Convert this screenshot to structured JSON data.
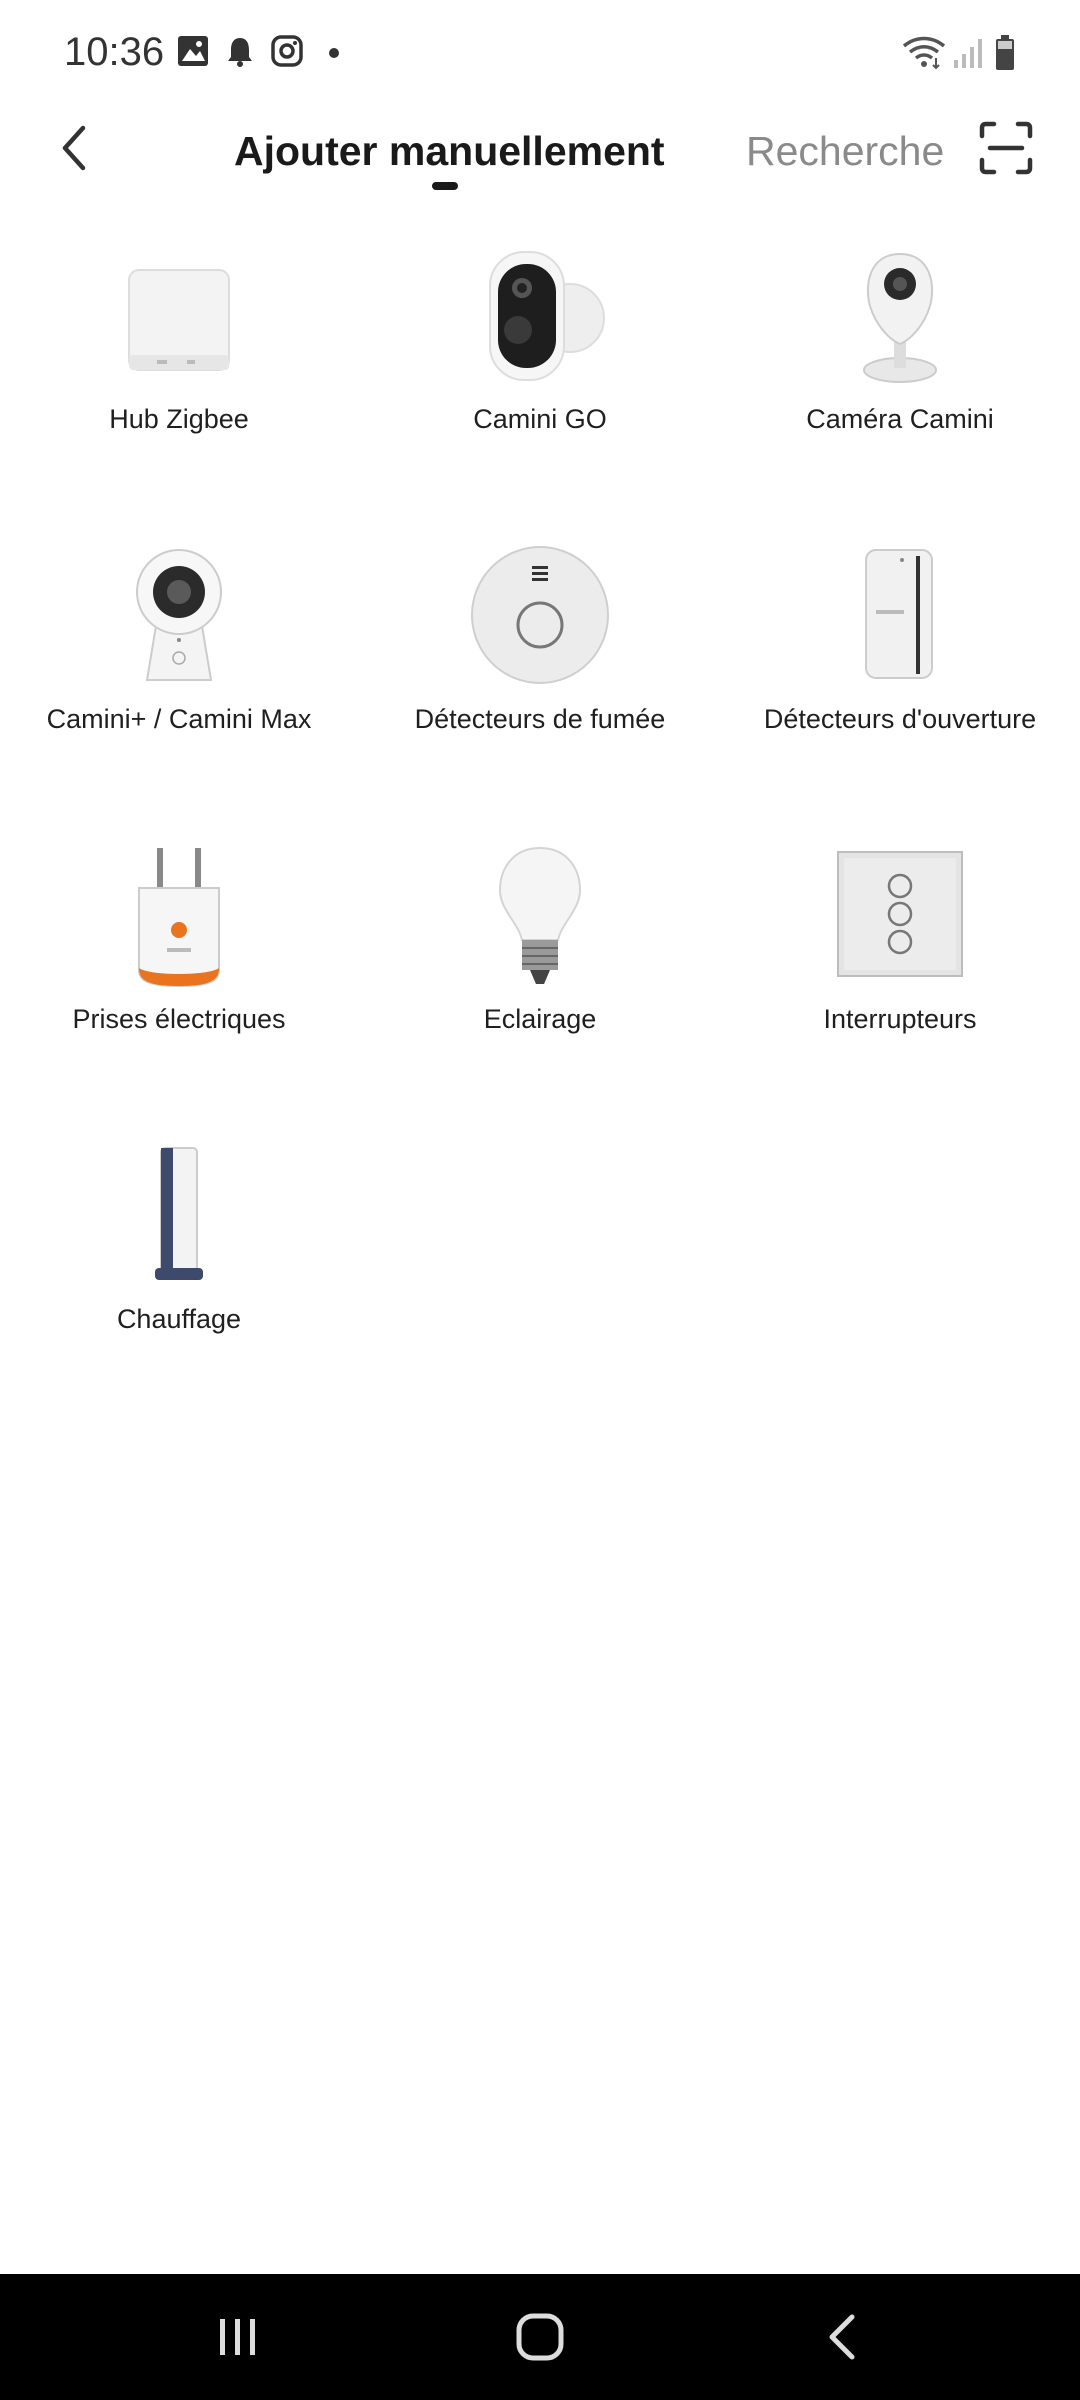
{
  "status_bar": {
    "time": "10:36",
    "icons": [
      "gallery-icon",
      "bell-icon",
      "instagram-icon",
      "dot-icon",
      "wifi-icon",
      "signal-icon",
      "battery-icon"
    ]
  },
  "header": {
    "back_icon": "chevron-left-icon",
    "active_tab": "Ajouter manuellement",
    "inactive_tab": "Recherche",
    "scan_icon": "scan-icon"
  },
  "devices": [
    {
      "label": "Hub Zigbee",
      "icon": "hub-zigbee-image"
    },
    {
      "label": "Camini GO",
      "icon": "camini-go-image"
    },
    {
      "label": "Caméra Camini",
      "icon": "camera-camini-image"
    },
    {
      "label": "Camini+ / Camini Max",
      "icon": "camini-plus-image"
    },
    {
      "label": "Détecteurs de fumée",
      "icon": "smoke-detector-image"
    },
    {
      "label": "Détecteurs d'ouverture",
      "icon": "door-sensor-image"
    },
    {
      "label": "Prises électriques",
      "icon": "smart-plug-image"
    },
    {
      "label": "Eclairage",
      "icon": "light-bulb-image"
    },
    {
      "label": "Interrupteurs",
      "icon": "wall-switch-image"
    },
    {
      "label": "Chauffage",
      "icon": "heater-image"
    }
  ],
  "nav_bar": {
    "icons": [
      "recent-apps-icon",
      "home-icon",
      "back-icon"
    ]
  },
  "colors": {
    "accent_orange": "#e9731f",
    "tab_active": "#1a1a1a",
    "tab_inactive": "#8a8a8a",
    "nav_background": "#000000"
  }
}
